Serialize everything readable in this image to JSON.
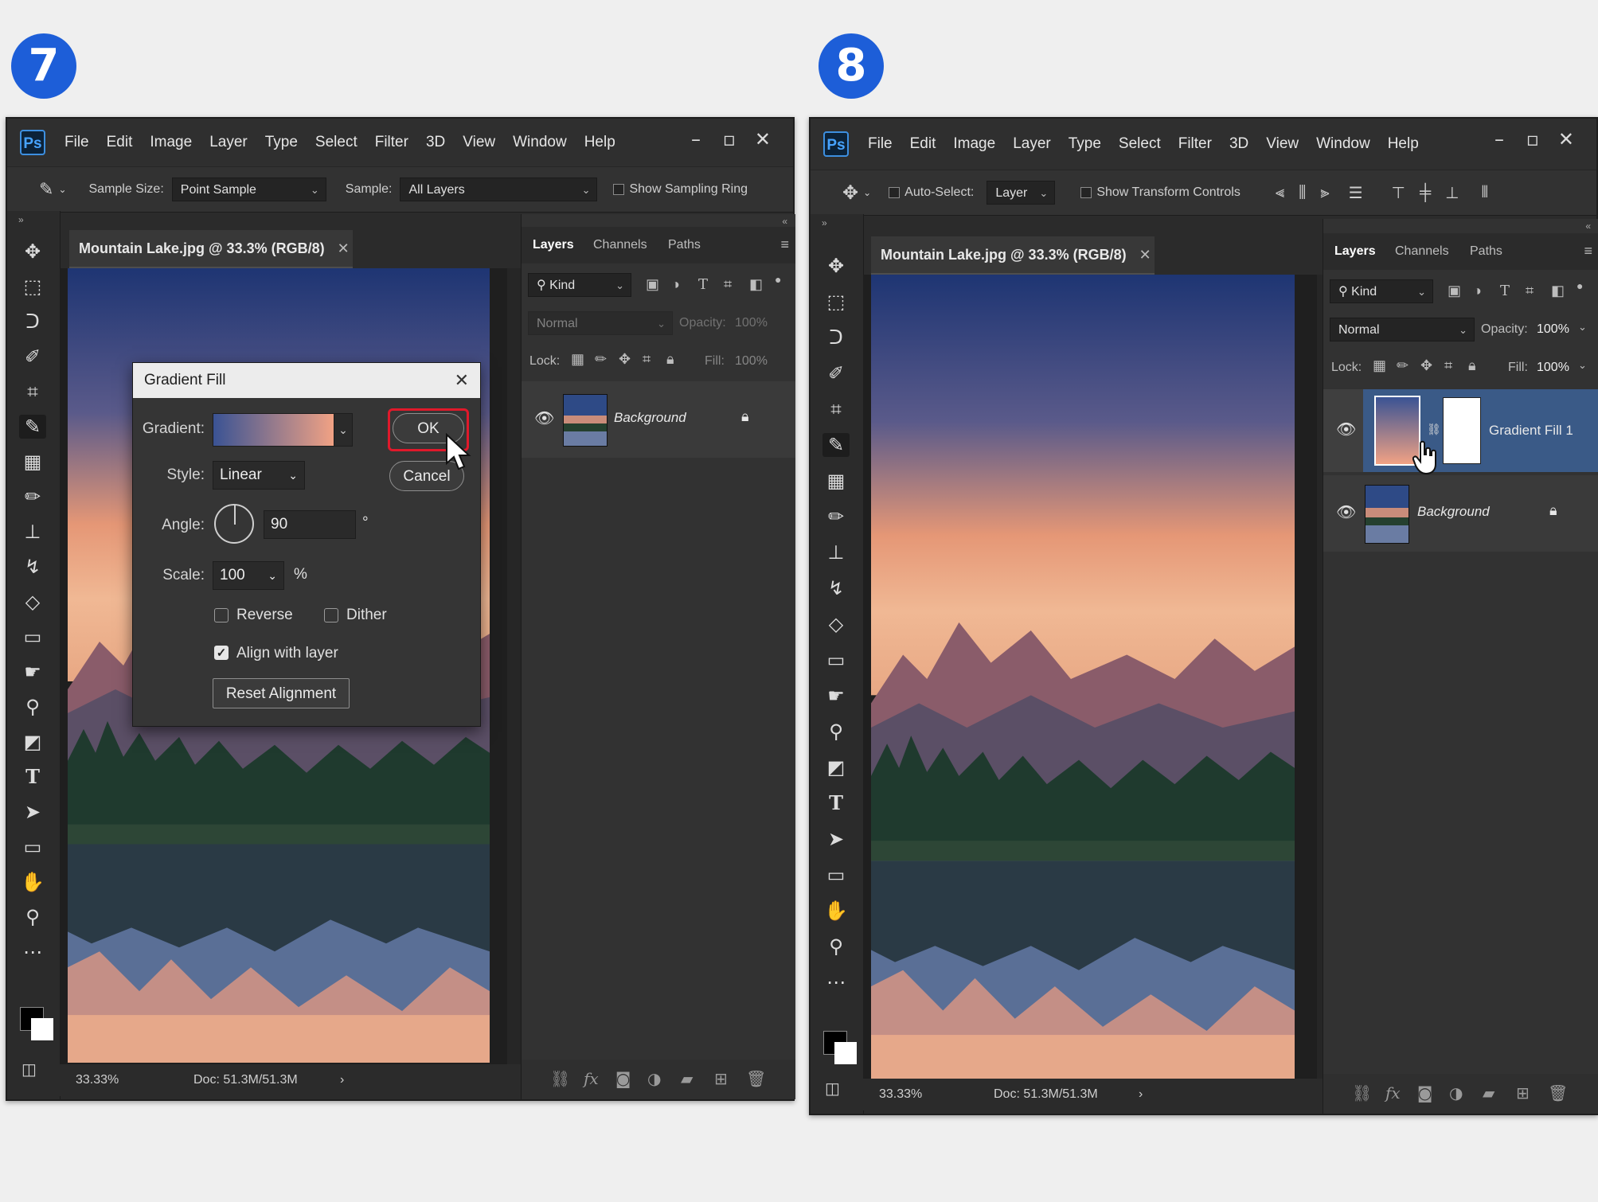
{
  "steps": {
    "left": "7",
    "right": "8"
  },
  "menu": [
    "File",
    "Edit",
    "Image",
    "Layer",
    "Type",
    "Select",
    "Filter",
    "3D",
    "View",
    "Window",
    "Help"
  ],
  "app": {
    "logo": "Ps"
  },
  "left": {
    "options": {
      "sample_size_label": "Sample Size:",
      "sample_size_value": "Point Sample",
      "sample_label": "Sample:",
      "sample_value": "All Layers",
      "sampling_ring": "Show Sampling Ring"
    },
    "doc_tab": "Mountain Lake.jpg @ 33.3% (RGB/8)",
    "status": {
      "zoom": "33.33%",
      "doc": "Doc: 51.3M/51.3M"
    },
    "layers_panel": {
      "tabs": [
        "Layers",
        "Channels",
        "Paths"
      ],
      "kind": "Kind",
      "blend": "Normal",
      "opacity_label": "Opacity:",
      "opacity": "100%",
      "lock_label": "Lock:",
      "fill_label": "Fill:",
      "fill": "100%",
      "layers": [
        {
          "name": "Background",
          "locked": true
        }
      ]
    }
  },
  "dialog": {
    "title": "Gradient Fill",
    "gradient_label": "Gradient:",
    "style_label": "Style:",
    "style_value": "Linear",
    "angle_label": "Angle:",
    "angle_value": "90",
    "degree": "°",
    "scale_label": "Scale:",
    "scale_value": "100",
    "percent": "%",
    "reverse": "Reverse",
    "dither": "Dither",
    "align": "Align with layer",
    "align_checked": true,
    "reset": "Reset Alignment",
    "ok": "OK",
    "cancel": "Cancel",
    "gradient_colors": [
      "#3a5394",
      "#f2a284"
    ]
  },
  "right": {
    "options": {
      "auto_select": "Auto-Select:",
      "auto_select_value": "Layer",
      "transform_controls": "Show Transform Controls"
    },
    "doc_tab": "Mountain Lake.jpg @ 33.3% (RGB/8)",
    "status": {
      "zoom": "33.33%",
      "doc": "Doc: 51.3M/51.3M"
    },
    "layers_panel": {
      "tabs": [
        "Layers",
        "Channels",
        "Paths"
      ],
      "kind": "Kind",
      "blend": "Normal",
      "opacity_label": "Opacity:",
      "opacity": "100%",
      "lock_label": "Lock:",
      "fill_label": "Fill:",
      "fill": "100%",
      "layers": [
        {
          "name": "Gradient Fill 1",
          "locked": false,
          "selected": true
        },
        {
          "name": "Background",
          "locked": true
        }
      ]
    }
  },
  "colors": {
    "accent_badge": "#1d5ed8",
    "highlight_red": "#e0192b",
    "selected_layer": "#3a5a87"
  },
  "icons": {
    "left_tools": [
      "move-icon",
      "marquee-icon",
      "lasso-icon",
      "quick-select-icon",
      "crop-icon",
      "eyedropper-icon",
      "healing-icon",
      "brush-icon",
      "stamp-icon",
      "history-brush-icon",
      "eraser-icon",
      "gradient-icon",
      "blur-icon",
      "dodge-icon",
      "pen-icon",
      "type-icon",
      "path-select-icon",
      "rectangle-icon",
      "hand-icon",
      "zoom-icon",
      "more-icon"
    ]
  }
}
